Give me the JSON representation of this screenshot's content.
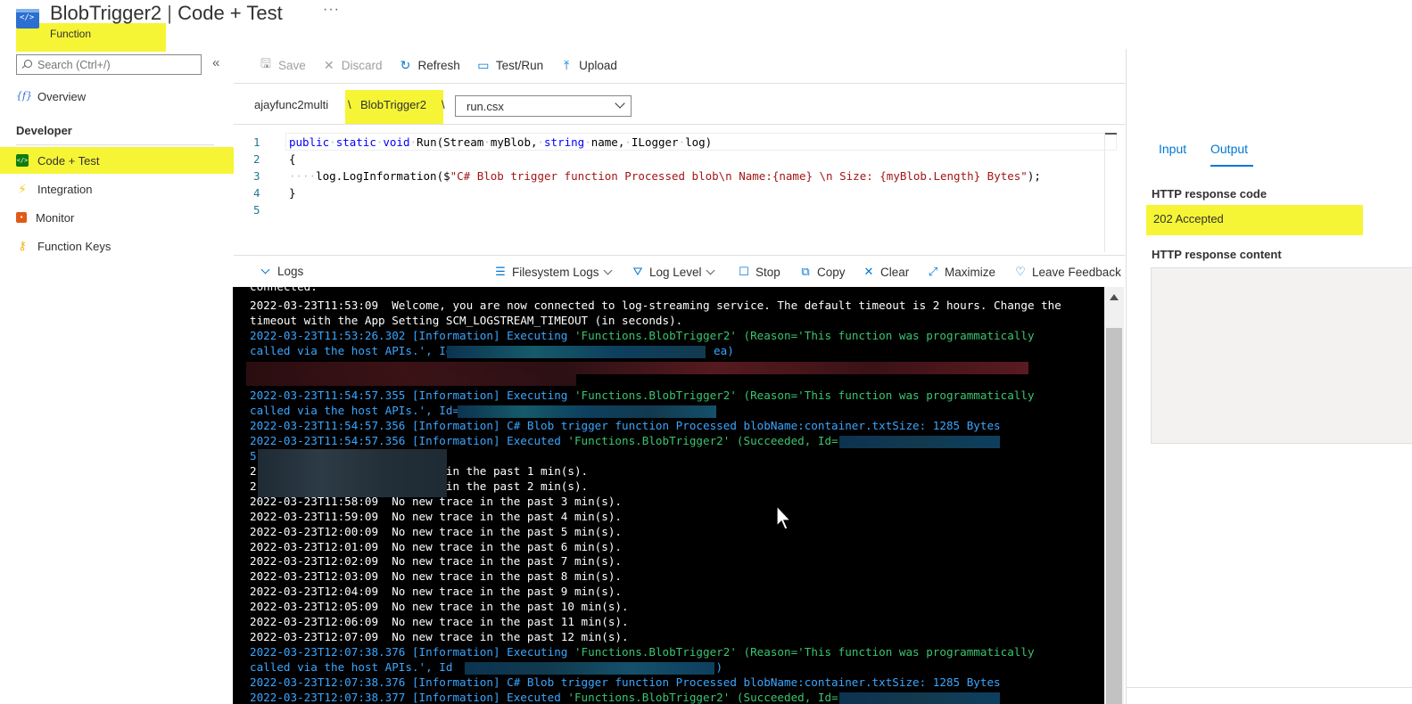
{
  "header": {
    "title": "BlobTrigger2",
    "title_separator": " | ",
    "title_section": "Code + Test",
    "more": "···",
    "subtitle": "Function"
  },
  "sidebar": {
    "search_placeholder": "Search (Ctrl+/)",
    "collapse": "«",
    "overview": "Overview",
    "section_developer": "Developer",
    "items": [
      {
        "label": "Code + Test",
        "icon": "code-icon",
        "active": true
      },
      {
        "label": "Integration",
        "icon": "lightning-icon"
      },
      {
        "label": "Monitor",
        "icon": "monitor-icon"
      },
      {
        "label": "Function Keys",
        "icon": "key-icon"
      }
    ]
  },
  "toolbar": {
    "save": "Save",
    "discard": "Discard",
    "refresh": "Refresh",
    "testrun": "Test/Run",
    "upload": "Upload"
  },
  "breadcrumb": {
    "app": "ajayfunc2multi",
    "sep": "\\",
    "function": "BlobTrigger2",
    "file": "run.csx"
  },
  "editor": {
    "line_numbers": [
      "1",
      "2",
      "3",
      "4",
      "5"
    ],
    "line1_kw1": "public",
    "line1_kw2": "static",
    "line1_kw3": "void",
    "line1_rest1": "Run(Stream",
    "line1_rest2": "myBlob,",
    "line1_kw4": "string",
    "line1_rest3": "name,",
    "line1_rest4": "ILogger",
    "line1_rest5": "log)",
    "line2": "{",
    "line3_pre": "log.LogInformation($",
    "line3_str": "\"C# Blob trigger function Processed blob\\n Name:{name} \\n Size: {myBlob.Length} Bytes\"",
    "line3_post": ");",
    "line4": "}"
  },
  "logs_bar": {
    "logs": "Logs",
    "filesystem": "Filesystem Logs",
    "level": "Log Level",
    "stop": "Stop",
    "copy": "Copy",
    "clear": "Clear",
    "maximize": "Maximize",
    "feedback": "Leave Feedback"
  },
  "console": {
    "l0": "connected.",
    "l1": "2022-03-23T11:53:09  Welcome, you are now connected to log-streaming service. The default timeout is 2 hours. Change the",
    "l2": "timeout with the App Setting SCM_LOGSTREAM_TIMEOUT (in seconds).",
    "l3a": "2022-03-23T11:53:26.302 [Information] Executing ",
    "l3b": "'Functions.BlobTrigger2' (Reason='This function was programmatically",
    "l4a": "called via the host APIs.', Id=",
    "l4b": "ea)",
    "l5a": "2022-03-23T11:54:57.355 [Information] Executing ",
    "l5b": "'Functions.BlobTrigger2' (Reason='This function was programmatically",
    "l6a": "called via the host APIs.', Id=",
    "l7": "2022-03-23T11:54:57.356 [Information] C# Blob trigger function Processed blobName:container.txtSize: 1285 Bytes",
    "l8a": "2022-03-23T11:54:57.356 [Information] Executed ",
    "l8b": "'Functions.BlobTrigger2' (Succeeded, Id=",
    "l9": "5",
    "l10": "2                      trace in the past 1 min(s).",
    "l11": "2                      trace in the past 2 min(s).",
    "l12": "2022-03-23T11:58:09  No new trace in the past 3 min(s).",
    "l13": "2022-03-23T11:59:09  No new trace in the past 4 min(s).",
    "l14": "2022-03-23T12:00:09  No new trace in the past 5 min(s).",
    "l15": "2022-03-23T12:01:09  No new trace in the past 6 min(s).",
    "l16": "2022-03-23T12:02:09  No new trace in the past 7 min(s).",
    "l17": "2022-03-23T12:03:09  No new trace in the past 8 min(s).",
    "l18": "2022-03-23T12:04:09  No new trace in the past 9 min(s).",
    "l19": "2022-03-23T12:05:09  No new trace in the past 10 min(s).",
    "l20": "2022-03-23T12:06:09  No new trace in the past 11 min(s).",
    "l21": "2022-03-23T12:07:09  No new trace in the past 12 min(s).",
    "l22a": "2022-03-23T12:07:38.376 [Information] Executing ",
    "l22b": "'Functions.BlobTrigger2' (Reason='This function was programmatically",
    "l23a": "called via the host APIs.', Id",
    "l23b": ")",
    "l24": "2022-03-23T12:07:38.376 [Information] C# Blob trigger function Processed blobName:container.txtSize: 1285 Bytes",
    "l25a": "2022-03-23T12:07:38.377 [Information] Executed ",
    "l25b": "'Functions.BlobTrigger2' (Succeeded, Id="
  },
  "right_panel": {
    "tab_input": "Input",
    "tab_output": "Output",
    "response_code_label": "HTTP response code",
    "response_code": "202 Accepted",
    "response_content_label": "HTTP response content"
  },
  "colors": {
    "highlight": "#f5f535",
    "accent": "#0078d4",
    "log_blue": "#3aa6ff",
    "log_green": "#3ac46e"
  }
}
